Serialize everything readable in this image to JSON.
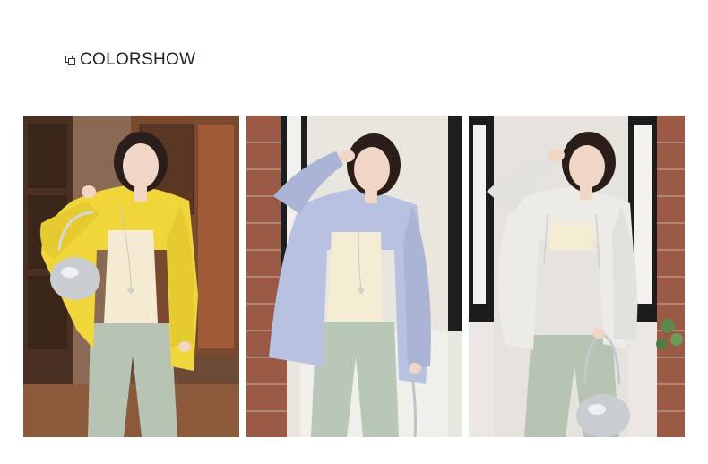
{
  "section": {
    "title": "COLORSHOW",
    "icon": "copy-squares-icon"
  },
  "photos": [
    {
      "name": "yellow-cardigan-model",
      "garment_color": "#f0d63a"
    },
    {
      "name": "lavender-blue-cardigan-model",
      "garment_color": "#b8c2e0"
    },
    {
      "name": "off-white-cardigan-model",
      "garment_color": "#ecebe6"
    }
  ]
}
